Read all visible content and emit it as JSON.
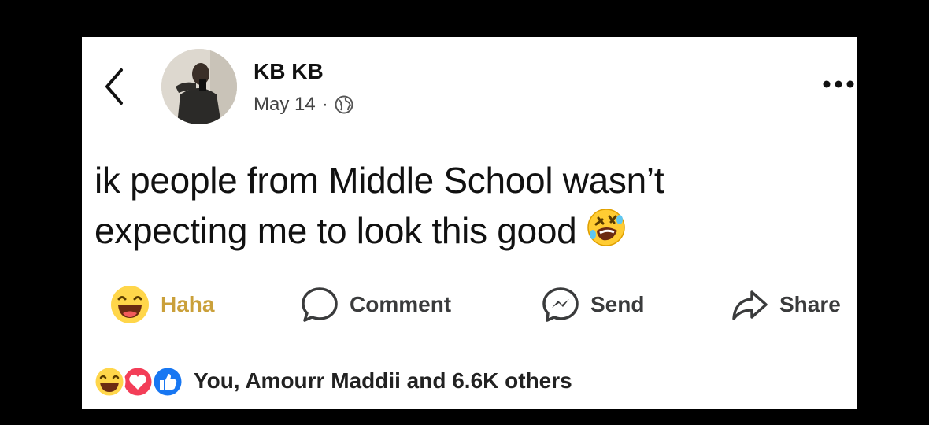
{
  "post": {
    "author": "KB KB",
    "date": "May 14",
    "separator": "·",
    "privacy_icon": "globe-icon",
    "text_line1": "ik people from Middle School wasn’t",
    "text_line2": "expecting me to look this good",
    "text_emoji": "rolling-on-floor-laughing-emoji"
  },
  "actions": {
    "haha_label": "Haha",
    "comment_label": "Comment",
    "send_label": "Send",
    "share_label": "Share"
  },
  "reactions": {
    "icons": [
      "haha-reaction-icon",
      "love-reaction-icon",
      "like-reaction-icon"
    ],
    "summary": "You, Amourr Maddii and 6.6K others"
  },
  "colors": {
    "haha_gold": "#caa03a",
    "love_red": "#f33e58",
    "like_blue": "#1877f2",
    "text": "#111111"
  }
}
